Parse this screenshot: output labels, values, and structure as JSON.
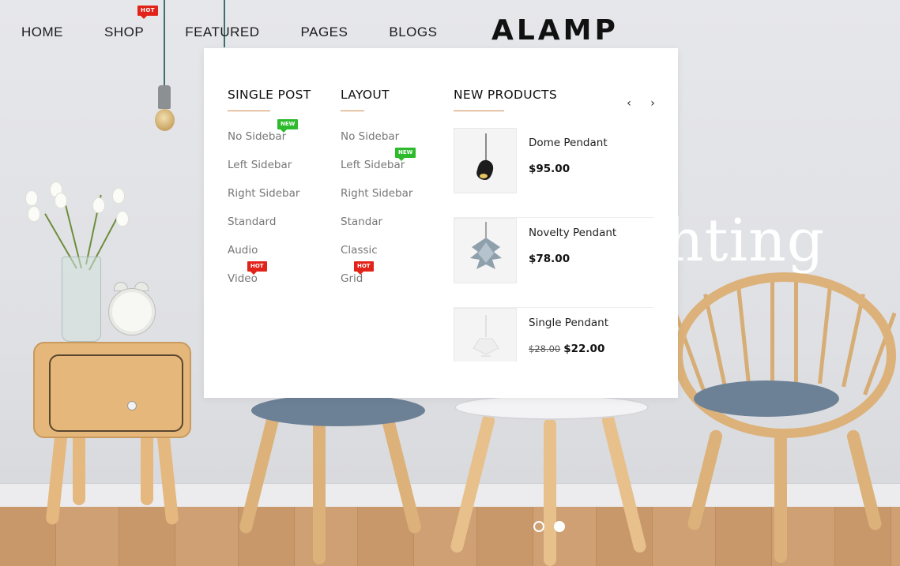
{
  "nav": {
    "items": [
      {
        "label": "HOME"
      },
      {
        "label": "SHOP",
        "badge": "HOT"
      },
      {
        "label": "FEATURED"
      },
      {
        "label": "PAGES"
      },
      {
        "label": "BLOGS"
      }
    ],
    "logo": "ALAMP"
  },
  "mega_menu": {
    "single_post": {
      "title": "SINGLE POST",
      "items": [
        {
          "label": "No Sidebar",
          "badge": "NEW"
        },
        {
          "label": "Left Sidebar"
        },
        {
          "label": "Right Sidebar"
        },
        {
          "label": "Standard"
        },
        {
          "label": "Audio"
        },
        {
          "label": "Video",
          "badge": "HOT"
        }
      ]
    },
    "layout": {
      "title": "LAYOUT",
      "items": [
        {
          "label": "No Sidebar"
        },
        {
          "label": "Left Sidebar",
          "badge": "NEW"
        },
        {
          "label": "Right Sidebar"
        },
        {
          "label": "Standar"
        },
        {
          "label": "Classic"
        },
        {
          "label": "Grid",
          "badge": "HOT"
        }
      ]
    },
    "new_products": {
      "title": "NEW PRODUCTS",
      "prev_icon": "‹",
      "next_icon": "›",
      "items": [
        {
          "name": "Dome Pendant",
          "price": "$95.00",
          "old_price": ""
        },
        {
          "name": "Novelty Pendant",
          "price": "$78.00",
          "old_price": ""
        },
        {
          "name": "Single Pendant",
          "price": "$22.00",
          "old_price": "$28.00"
        }
      ]
    }
  },
  "hero": {
    "visible_text": "hting",
    "slides": 2,
    "active_slide": 2
  },
  "colors": {
    "accent_underline": "#d0894f",
    "badge_hot": "#e2231a",
    "badge_new": "#2dbb2d"
  },
  "icons": [
    "prev-arrow-icon",
    "next-arrow-icon",
    "pendant-lamp-icon"
  ]
}
